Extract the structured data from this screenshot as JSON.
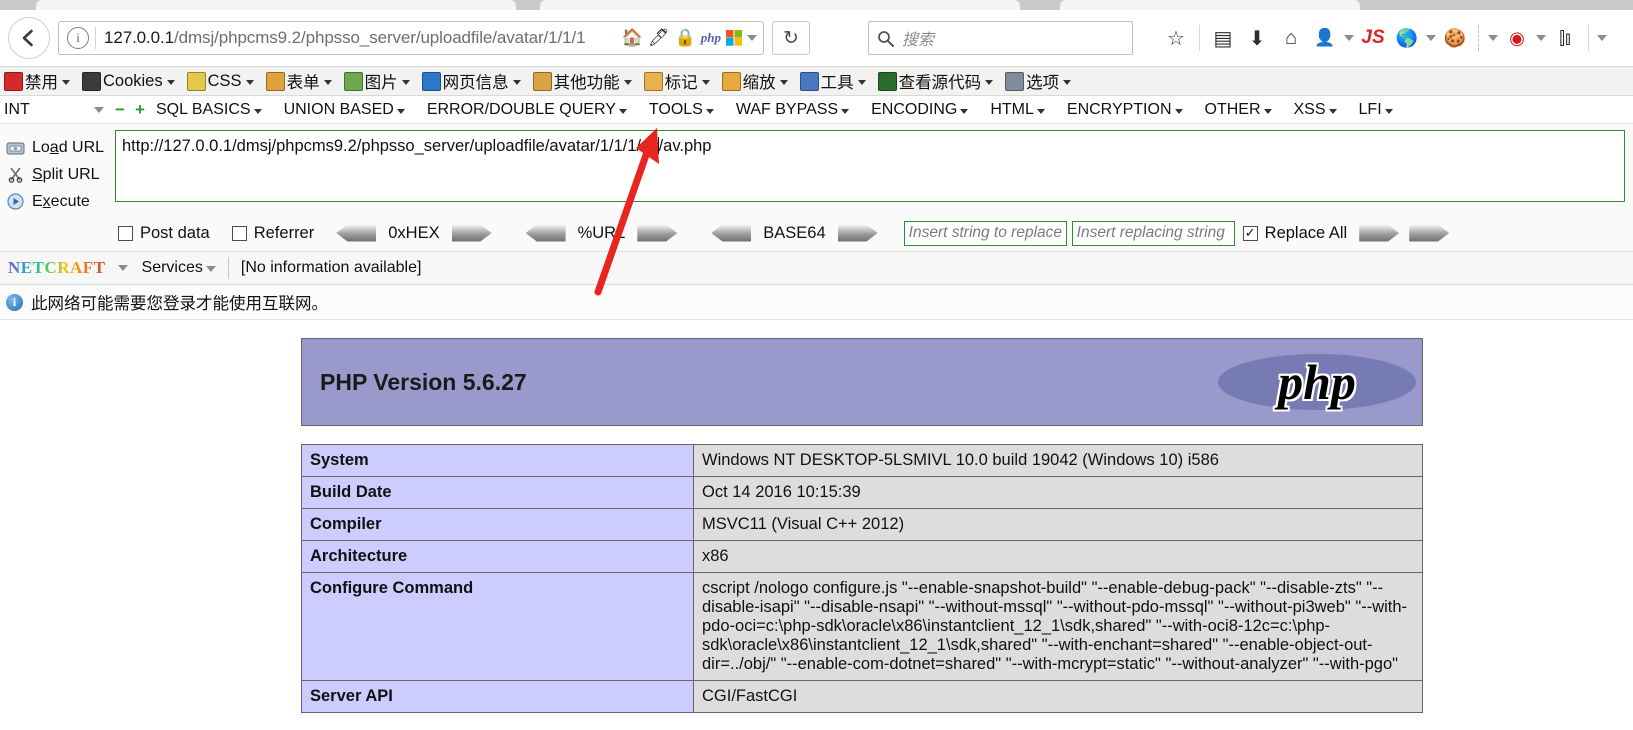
{
  "browser": {
    "back_label": "Back",
    "url_host": "127.0.0.1",
    "url_path": "/dmsj/phpcms9.2/phpsso_server/uploadfile/avatar/1/1/1",
    "url_badges": [
      "home-icon",
      "pencil-icon",
      "lock-icon",
      "php-icon",
      "windows-icon"
    ],
    "reload_label": "↻",
    "search_placeholder": "搜索",
    "icons": [
      "search-icon",
      "bookmark-star-icon",
      "library-icon",
      "download-icon",
      "home-icon",
      "user-avatar-icon",
      "js-icon",
      "firebug-icon",
      "cookie-icon",
      "tamper-data-icon",
      "sidebar-icon"
    ],
    "js_label": "JS"
  },
  "webdev_toolbar": {
    "items": [
      {
        "label": "禁用",
        "icon": "disable-icon",
        "color": "#d42a2a"
      },
      {
        "label": "Cookies",
        "icon": "cookie-jar-icon",
        "color": "#3b3b3b"
      },
      {
        "label": "CSS",
        "icon": "css-pencil-icon",
        "color": "#e5c84a"
      },
      {
        "label": "表单",
        "icon": "form-clipboard-icon",
        "color": "#e0a33c"
      },
      {
        "label": "图片",
        "icon": "images-icon",
        "color": "#6ea84f"
      },
      {
        "label": "网页信息",
        "icon": "info-icon",
        "color": "#2a79c6"
      },
      {
        "label": "其他功能",
        "icon": "misc-icon",
        "color": "#d9a441"
      },
      {
        "label": "标记",
        "icon": "outline-pencil-icon",
        "color": "#e8b34a"
      },
      {
        "label": "缩放",
        "icon": "resize-ruler-icon",
        "color": "#e6a93d"
      },
      {
        "label": "工具",
        "icon": "tools-icon",
        "color": "#4a77c2"
      },
      {
        "label": "查看源代码",
        "icon": "view-source-icon",
        "color": "#2d6b2d"
      },
      {
        "label": "选项",
        "icon": "options-icon",
        "color": "#7f8c99"
      }
    ]
  },
  "hackbar": {
    "tab_selected": "INT",
    "remove_label": "−",
    "add_label": "+",
    "menus": [
      "SQL BASICS",
      "UNION BASED",
      "ERROR/DOUBLE QUERY",
      "TOOLS",
      "WAF BYPASS",
      "ENCODING",
      "HTML",
      "ENCRYPTION",
      "OTHER",
      "XSS",
      "LFI"
    ],
    "actions": [
      {
        "label": "Load URL",
        "icon": "load-url-icon",
        "accel": "a"
      },
      {
        "label": "Split URL",
        "icon": "split-url-scissors-icon",
        "accel": "S"
      },
      {
        "label": "Execute",
        "icon": "execute-play-icon",
        "accel": "x"
      }
    ],
    "url_value_before_caret": "http://127.0.0.1/dmsj/phpcms9.2/phpsso_server/uploadfile/avatar/1/1/1/av",
    "url_value_after_caret": "/av.php",
    "post_data_label": "Post data",
    "post_data_checked": false,
    "referrer_label": "Referrer",
    "referrer_checked": false,
    "converters": [
      "0xHEX",
      "%URL",
      "BASE64"
    ],
    "replace_search_placeholder": "Insert string to replace",
    "replace_with_placeholder": "Insert replacing string",
    "replace_all_label": "Replace All",
    "replace_all_checked": true
  },
  "netcraft": {
    "logo_text": "NETCRAFT",
    "services_label": "Services",
    "risk_text": "[No information available]"
  },
  "notification": {
    "icon": "info-icon",
    "text": "此网络可能需要您登录才能使用互联网。"
  },
  "phpinfo": {
    "title": "PHP Version 5.6.27",
    "logo_text": "php",
    "header_bg": "#9999cc",
    "key_bg": "#ccccff",
    "value_bg": "#dddddd",
    "rows": [
      {
        "key": "System",
        "value": "Windows NT DESKTOP-5LSMIVL 10.0 build 19042 (Windows 10) i586"
      },
      {
        "key": "Build Date",
        "value": "Oct 14 2016 10:15:39"
      },
      {
        "key": "Compiler",
        "value": "MSVC11 (Visual C++ 2012)"
      },
      {
        "key": "Architecture",
        "value": "x86"
      },
      {
        "key": "Configure Command",
        "value": "cscript /nologo configure.js \"--enable-snapshot-build\" \"--enable-debug-pack\" \"--disable-zts\" \"--disable-isapi\" \"--disable-nsapi\" \"--without-mssql\" \"--without-pdo-mssql\" \"--without-pi3web\" \"--with-pdo-oci=c:\\php-sdk\\oracle\\x86\\instantclient_12_1\\sdk,shared\" \"--with-oci8-12c=c:\\php-sdk\\oracle\\x86\\instantclient_12_1\\sdk,shared\" \"--with-enchant=shared\" \"--enable-object-out-dir=../obj/\" \"--enable-com-dotnet=shared\" \"--with-mcrypt=static\" \"--without-analyzer\" \"--with-pgo\""
      },
      {
        "key": "Server API",
        "value": "CGI/FastCGI"
      }
    ]
  },
  "annotation": {
    "type": "red-arrow",
    "color": "#e8241f"
  }
}
